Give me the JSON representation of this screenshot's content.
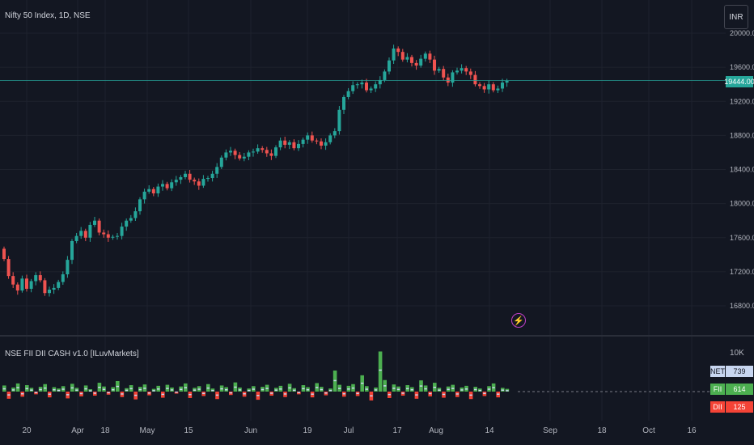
{
  "header": {
    "symbol": "Nifty 50 Index, 1D, NSE",
    "currency_button": "INR"
  },
  "indicator": {
    "title": "NSE FII DII CASH v1.0 [ILuvMarkets]",
    "scale_label": "10K"
  },
  "badges": {
    "last_price": "19444.00",
    "net_label": "NET",
    "net_value": "739",
    "fii_label": "FII",
    "fii_value": "614",
    "dii_label": "DII",
    "dii_value": "125"
  },
  "colors": {
    "up": "#26a69a",
    "down": "#ef5350",
    "fii": "#4caf50",
    "dii": "#f44336",
    "net": "#c8d6f0",
    "grid": "#1e222d",
    "price_line": "#26a69a"
  },
  "chart_data": {
    "type": "candlestick",
    "price_axis_ticks": [
      "20000.00",
      "19600.00",
      "19200.00",
      "18800.00",
      "18400.00",
      "18000.00",
      "17600.00",
      "17200.00",
      "16800.00"
    ],
    "x_axis_ticks": [
      "20",
      "Apr",
      "18",
      "May",
      "15",
      "Jun",
      "19",
      "Jul",
      "17",
      "Aug",
      "14",
      "Sep",
      "18",
      "Oct",
      "16"
    ],
    "closes": [
      17350,
      17150,
      17050,
      16980,
      17120,
      17000,
      17090,
      17160,
      17100,
      16950,
      16990,
      17010,
      17080,
      17170,
      17340,
      17560,
      17620,
      17680,
      17600,
      17750,
      17800,
      17660,
      17640,
      17600,
      17610,
      17620,
      17730,
      17800,
      17830,
      17910,
      18050,
      18140,
      18170,
      18120,
      18200,
      18230,
      18180,
      18250,
      18280,
      18310,
      18350,
      18280,
      18260,
      18210,
      18290,
      18300,
      18350,
      18430,
      18540,
      18600,
      18620,
      18570,
      18530,
      18550,
      18600,
      18610,
      18650,
      18630,
      18590,
      18560,
      18660,
      18740,
      18690,
      18720,
      18650,
      18700,
      18750,
      18800,
      18740,
      18730,
      18680,
      18720,
      18800,
      18850,
      19100,
      19250,
      19320,
      19390,
      19400,
      19420,
      19330,
      19350,
      19400,
      19450,
      19550,
      19680,
      19820,
      19780,
      19690,
      19720,
      19650,
      19620,
      19700,
      19760,
      19690,
      19560,
      19580,
      19480,
      19420,
      19540,
      19560,
      19590,
      19550,
      19510,
      19400,
      19380,
      19340,
      19400,
      19330,
      19350,
      19420,
      19440
    ],
    "fii_dii_net_bars": [
      1.8,
      -2.1,
      1.2,
      2.4,
      -1.5,
      1.9,
      1.1,
      -0.8,
      1.4,
      2.2,
      -1.7,
      1.3,
      0.9,
      1.6,
      -2.0,
      2.3,
      1.1,
      -1.4,
      1.8,
      0.7,
      -1.2,
      2.6,
      1.5,
      -0.9,
      1.3,
      3.1,
      -1.6,
      1.0,
      1.9,
      -2.3,
      1.4,
      2.1,
      -1.1,
      0.8,
      1.7,
      -1.8,
      2.0,
      1.2,
      -0.6,
      1.5,
      2.4,
      -1.9,
      1.1,
      1.6,
      -1.3,
      2.2,
      0.9,
      -2.2,
      1.8,
      1.3,
      -1.0,
      2.7,
      1.2,
      -1.5,
      0.9,
      1.6,
      -2.4,
      1.4,
      2.0,
      -1.2,
      1.1,
      1.7,
      -1.6,
      2.3,
      1.0,
      -0.8,
      1.9,
      1.3,
      -1.7,
      2.5,
      1.4,
      -1.1,
      0.9,
      6.2,
      2.0,
      -1.5,
      1.7,
      2.2,
      -1.3,
      4.8,
      1.6,
      -2.6,
      1.2,
      11.8,
      3.4,
      -1.9,
      2.1,
      1.5,
      -1.2,
      1.9,
      1.3,
      -2.1,
      3.3,
      1.8,
      -1.4,
      2.6,
      1.1,
      -1.8,
      1.5,
      2.0,
      -1.6,
      1.2,
      1.7,
      -2.2,
      1.4,
      0.9,
      -1.3,
      1.6,
      2.4,
      -1.7,
      1.1,
      0.8
    ]
  }
}
